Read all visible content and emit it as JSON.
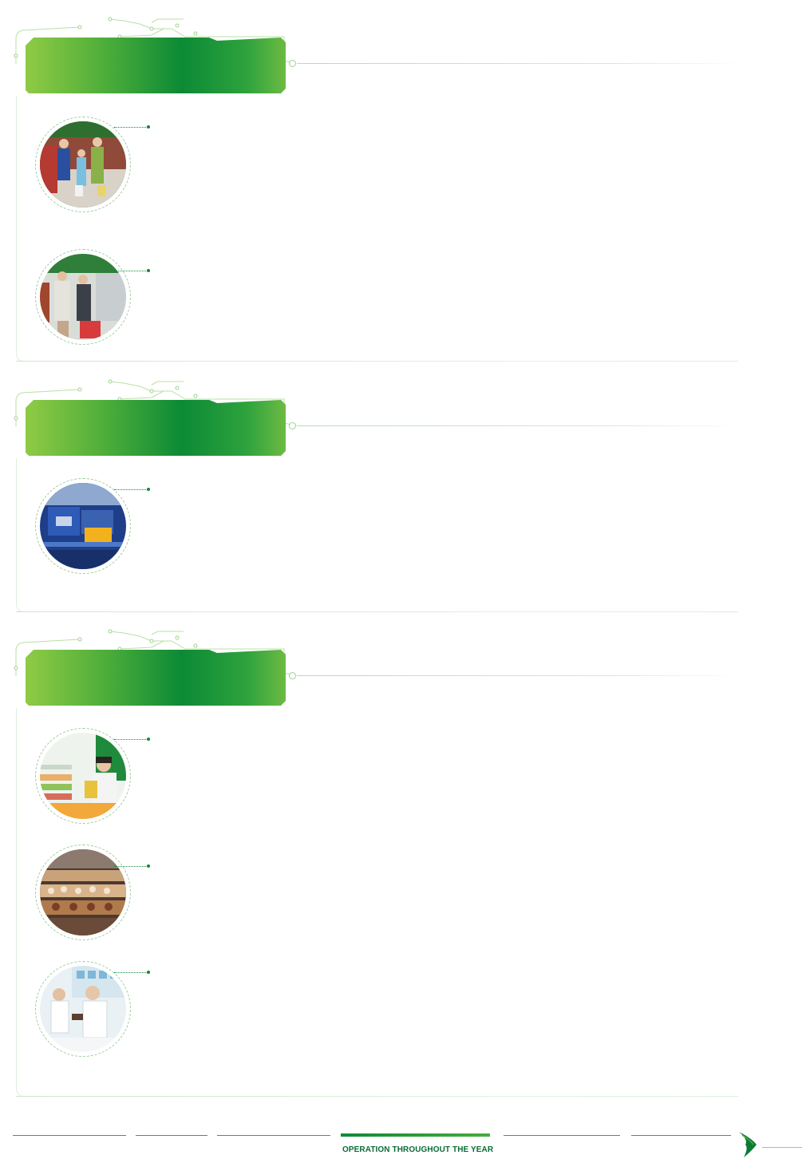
{
  "sections": [
    {
      "id": "section-1",
      "banner_text": "",
      "photos": [
        {
          "name": "family-shoppers-photo",
          "alt": ""
        },
        {
          "name": "customers-in-store-photo",
          "alt": ""
        }
      ]
    },
    {
      "id": "section-2",
      "banner_text": "",
      "photos": [
        {
          "name": "factory-machinery-photo",
          "alt": ""
        }
      ]
    },
    {
      "id": "section-3",
      "banner_text": "",
      "photos": [
        {
          "name": "store-staff-photo",
          "alt": ""
        },
        {
          "name": "bakery-shelves-photo",
          "alt": ""
        },
        {
          "name": "pharmacy-staff-photo",
          "alt": ""
        }
      ]
    }
  ],
  "footer": {
    "active_label": "OPERATION THROUGHOUT THE YEAR",
    "colors": {
      "brand_green": "#0c8a36",
      "accent_green": "#49ad3c",
      "label": "#0a6b36"
    },
    "icon": "next-arrow-icon"
  }
}
